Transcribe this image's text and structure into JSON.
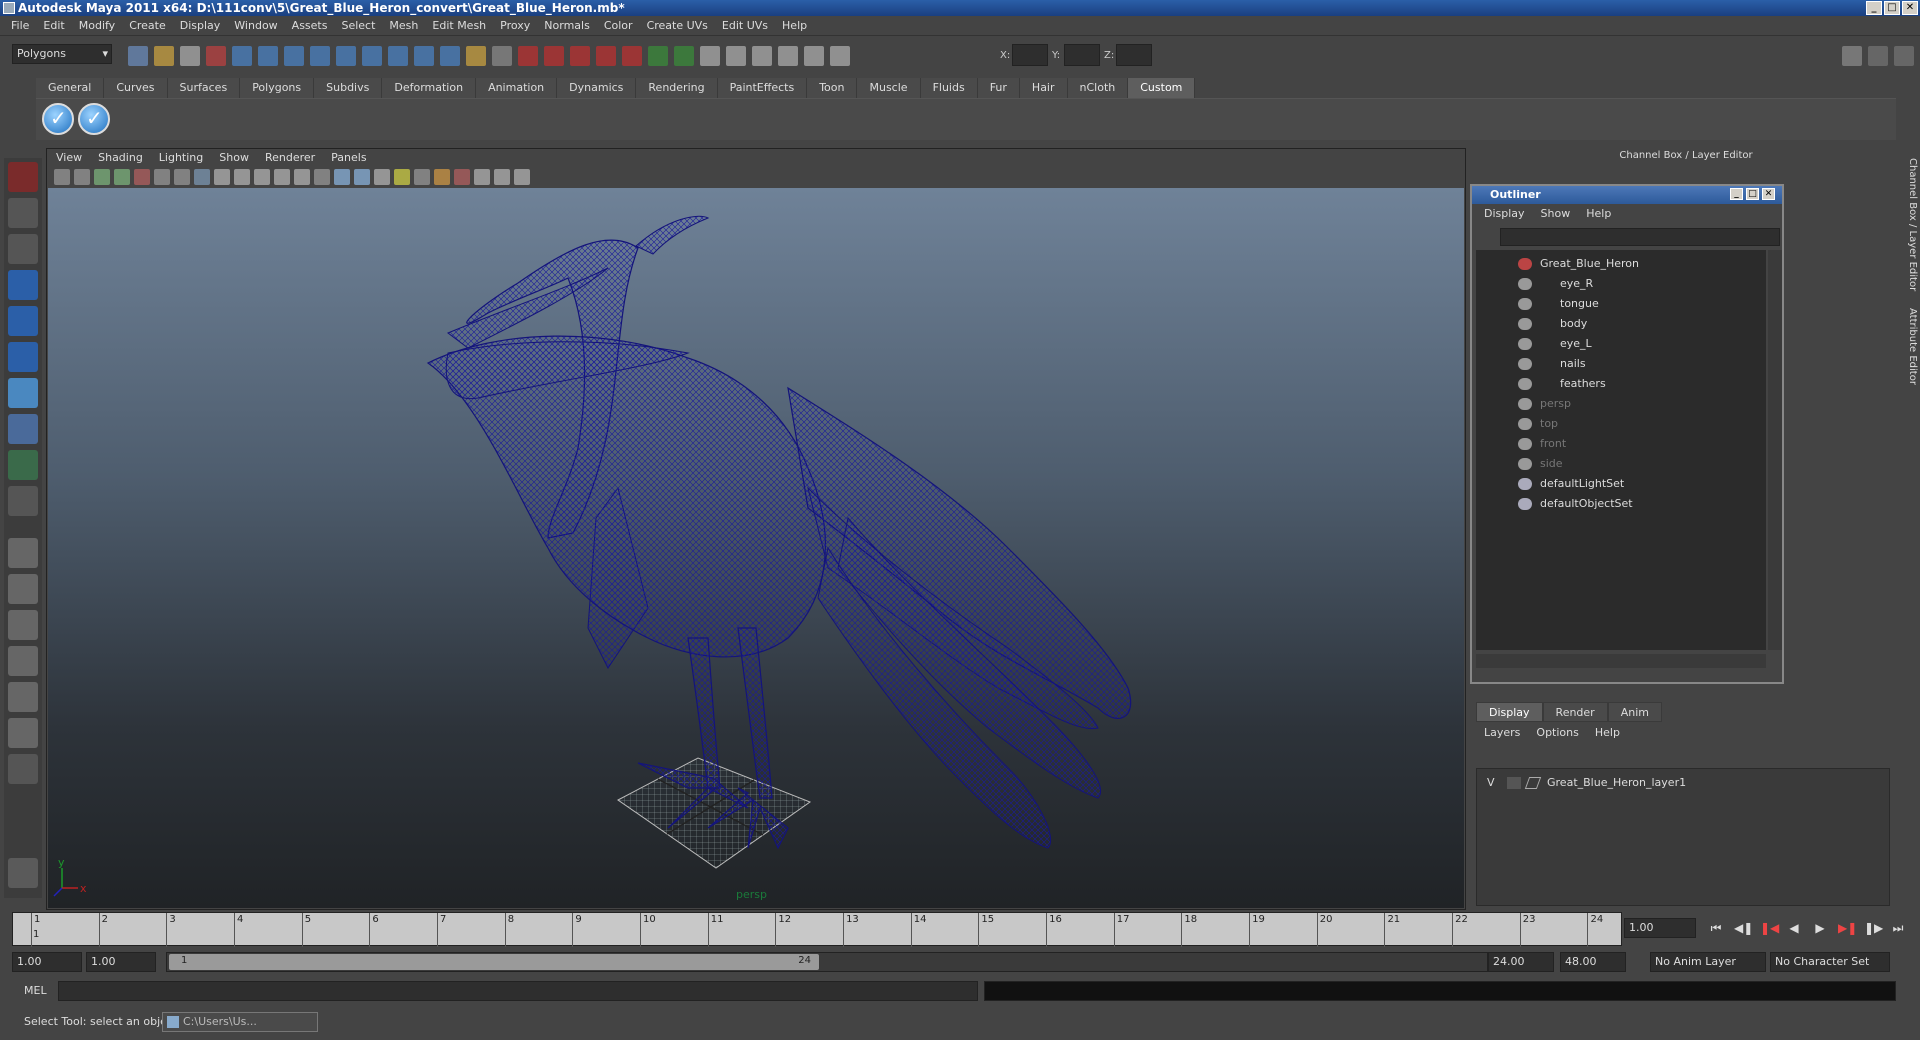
{
  "window": {
    "title": "Autodesk Maya 2011 x64: D:\\111conv\\5\\Great_Blue_Heron_convert\\Great_Blue_Heron.mb*"
  },
  "menubar": [
    "File",
    "Edit",
    "Modify",
    "Create",
    "Display",
    "Window",
    "Assets",
    "Select",
    "Mesh",
    "Edit Mesh",
    "Proxy",
    "Normals",
    "Color",
    "Create UVs",
    "Edit UVs",
    "Help"
  ],
  "statusline": {
    "mode": "Polygons",
    "x_label": "X:",
    "y_label": "Y:",
    "z_label": "Z:"
  },
  "shelf": {
    "tabs": [
      "General",
      "Curves",
      "Surfaces",
      "Polygons",
      "Subdivs",
      "Deformation",
      "Animation",
      "Dynamics",
      "Rendering",
      "PaintEffects",
      "Toon",
      "Muscle",
      "Fluids",
      "Fur",
      "Hair",
      "nCloth",
      "Custom"
    ],
    "active": "Custom"
  },
  "viewport": {
    "menu": [
      "View",
      "Shading",
      "Lighting",
      "Show",
      "Renderer",
      "Panels"
    ],
    "camera": "persp",
    "axis_y": "y",
    "axis_x": "x",
    "wire_color": "#14147a"
  },
  "channelbox": {
    "header": "Channel Box / Layer Editor"
  },
  "outliner": {
    "title": "Outliner",
    "menu": [
      "Display",
      "Show",
      "Help"
    ],
    "items": [
      {
        "label": "Great_Blue_Heron",
        "indent": 0,
        "dim": false
      },
      {
        "label": "eye_R",
        "indent": 1,
        "dim": false
      },
      {
        "label": "tongue",
        "indent": 1,
        "dim": false
      },
      {
        "label": "body",
        "indent": 1,
        "dim": false
      },
      {
        "label": "eye_L",
        "indent": 1,
        "dim": false
      },
      {
        "label": "nails",
        "indent": 1,
        "dim": false
      },
      {
        "label": "feathers",
        "indent": 1,
        "dim": false
      },
      {
        "label": "persp",
        "indent": 0,
        "dim": true
      },
      {
        "label": "top",
        "indent": 0,
        "dim": true
      },
      {
        "label": "front",
        "indent": 0,
        "dim": true
      },
      {
        "label": "side",
        "indent": 0,
        "dim": true
      },
      {
        "label": "defaultLightSet",
        "indent": 0,
        "dim": false
      },
      {
        "label": "defaultObjectSet",
        "indent": 0,
        "dim": false
      }
    ]
  },
  "layers": {
    "tabs": [
      "Display",
      "Render",
      "Anim"
    ],
    "menu": [
      "Layers",
      "Options",
      "Help"
    ],
    "row": {
      "visible": "V",
      "name": "Great_Blue_Heron_layer1"
    }
  },
  "sidetabs": [
    "Channel Box / Layer Editor",
    "Attribute Editor"
  ],
  "timeline": {
    "ticks": [
      "1",
      "2",
      "3",
      "4",
      "5",
      "6",
      "7",
      "8",
      "9",
      "10",
      "11",
      "12",
      "13",
      "14",
      "15",
      "16",
      "17",
      "18",
      "19",
      "20",
      "21",
      "22",
      "23",
      "24"
    ],
    "current_frame": "1.00",
    "current_marker": "1"
  },
  "range": {
    "start": "1.00",
    "playback_start": "1.00",
    "handle_start": "1",
    "handle_end": "24",
    "playback_end": "24.00",
    "end": "48.00",
    "anim_layer": "No Anim Layer",
    "character_set": "No Character Set"
  },
  "mel": {
    "label": "MEL"
  },
  "help": {
    "text": "Select Tool: select an object",
    "task": "C:\\Users\\Us..."
  }
}
